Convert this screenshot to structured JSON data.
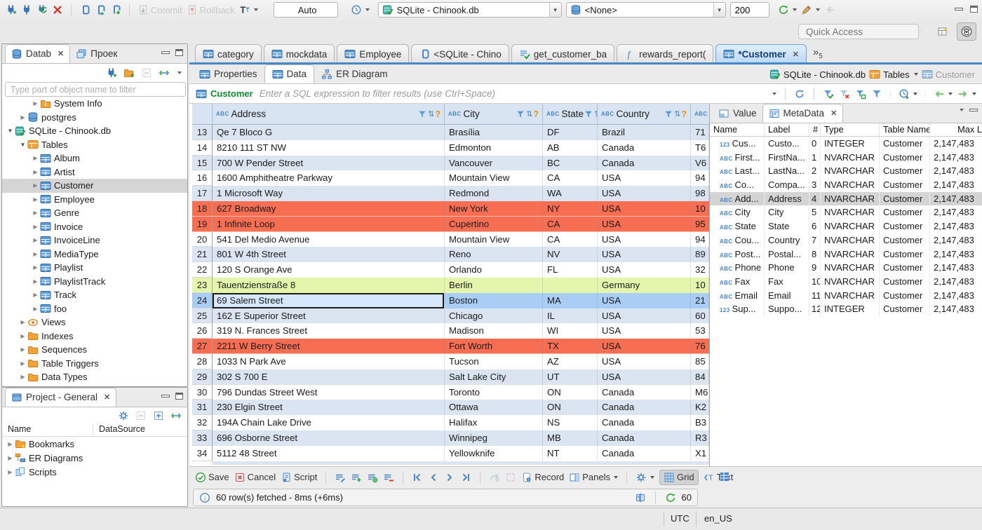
{
  "main_toolbar": {
    "commit": "Commit",
    "rollback": "Rollback",
    "txn_mode": "Auto",
    "connection": "SQLite - Chinook.db",
    "schema": "<None>",
    "fetch_size": "200",
    "quick_access_placeholder": "Quick Access"
  },
  "nav_panel": {
    "tab_database": "Datab",
    "tab_projects": "Проек",
    "filter_placeholder": "Type part of object name to filter",
    "tree": [
      {
        "label": "System Info",
        "icon": "folder-info",
        "indent": 2,
        "arrow": "right"
      },
      {
        "label": "postgres",
        "icon": "db",
        "indent": 1,
        "arrow": "right"
      },
      {
        "label": "SQLite - Chinook.db",
        "icon": "db-check",
        "indent": 0,
        "arrow": "down"
      },
      {
        "label": "Tables",
        "icon": "folder-table",
        "indent": 1,
        "arrow": "down"
      },
      {
        "label": "Album",
        "icon": "table",
        "indent": 2,
        "arrow": "right"
      },
      {
        "label": "Artist",
        "icon": "table",
        "indent": 2,
        "arrow": "right"
      },
      {
        "label": "Customer",
        "icon": "table",
        "indent": 2,
        "arrow": "right",
        "selected": true
      },
      {
        "label": "Employee",
        "icon": "table",
        "indent": 2,
        "arrow": "right"
      },
      {
        "label": "Genre",
        "icon": "table",
        "indent": 2,
        "arrow": "right"
      },
      {
        "label": "Invoice",
        "icon": "table",
        "indent": 2,
        "arrow": "right"
      },
      {
        "label": "InvoiceLine",
        "icon": "table",
        "indent": 2,
        "arrow": "right"
      },
      {
        "label": "MediaType",
        "icon": "table",
        "indent": 2,
        "arrow": "right"
      },
      {
        "label": "Playlist",
        "icon": "table",
        "indent": 2,
        "arrow": "right"
      },
      {
        "label": "PlaylistTrack",
        "icon": "table",
        "indent": 2,
        "arrow": "right"
      },
      {
        "label": "Track",
        "icon": "table",
        "indent": 2,
        "arrow": "right"
      },
      {
        "label": "foo",
        "icon": "table",
        "indent": 2,
        "arrow": "right"
      },
      {
        "label": "Views",
        "icon": "eye",
        "indent": 1,
        "arrow": "right"
      },
      {
        "label": "Indexes",
        "icon": "folder",
        "indent": 1,
        "arrow": "right"
      },
      {
        "label": "Sequences",
        "icon": "folder",
        "indent": 1,
        "arrow": "right"
      },
      {
        "label": "Table Triggers",
        "icon": "folder",
        "indent": 1,
        "arrow": "right"
      },
      {
        "label": "Data Types",
        "icon": "folder",
        "indent": 1,
        "arrow": "right"
      }
    ]
  },
  "project_panel": {
    "title": "Project - General",
    "columns": [
      "Name",
      "DataSource"
    ],
    "tree": [
      {
        "label": "Bookmarks",
        "icon": "folder-star",
        "indent": 0,
        "arrow": "right"
      },
      {
        "label": "ER Diagrams",
        "icon": "er",
        "indent": 0,
        "arrow": "right"
      },
      {
        "label": "Scripts",
        "icon": "scripts",
        "indent": 0,
        "arrow": "right"
      }
    ]
  },
  "editor_tabs": [
    {
      "label": "category",
      "icon": "table"
    },
    {
      "label": "mockdata",
      "icon": "table"
    },
    {
      "label": "Employee",
      "icon": "table"
    },
    {
      "label": "<SQLite - Chino",
      "icon": "sql"
    },
    {
      "label": "get_customer_ba",
      "icon": "script-check"
    },
    {
      "label": "rewards_report(",
      "icon": "function"
    },
    {
      "label": "*Customer",
      "icon": "table",
      "active": true,
      "closable": true
    }
  ],
  "tab_overflow_count": "5",
  "subtabs": [
    {
      "label": "Properties",
      "icon": "table"
    },
    {
      "label": "Data",
      "icon": "table",
      "active": true
    },
    {
      "label": "ER Diagram",
      "icon": "diagram"
    }
  ],
  "breadcrumb": [
    {
      "label": "SQLite - Chinook.db",
      "icon": "db-check"
    },
    {
      "label": "Tables",
      "icon": "folder-table",
      "dropdown": true
    },
    {
      "label": "Customer",
      "icon": "table",
      "muted": true
    }
  ],
  "filter_bar": {
    "entity": "Customer",
    "placeholder": "Enter a SQL expression to filter results (use Ctrl+Space)"
  },
  "grid": {
    "columns": [
      "Address",
      "City",
      "State",
      "Country"
    ],
    "partial_column_type": "ABC",
    "rows": [
      {
        "n": "13",
        "address": "Qe 7 Bloco G",
        "city": "Brasília",
        "state": "DF",
        "country": "Brazil",
        "postal": "71",
        "color": "stripe"
      },
      {
        "n": "14",
        "address": "8210 111 ST NW",
        "city": "Edmonton",
        "state": "AB",
        "country": "Canada",
        "postal": "T6",
        "color": "white"
      },
      {
        "n": "15",
        "address": "700 W Pender Street",
        "city": "Vancouver",
        "state": "BC",
        "country": "Canada",
        "postal": "V6",
        "color": "stripe"
      },
      {
        "n": "16",
        "address": "1600 Amphitheatre Parkway",
        "city": "Mountain View",
        "state": "CA",
        "country": "USA",
        "postal": "94",
        "color": "white"
      },
      {
        "n": "17",
        "address": "1 Microsoft Way",
        "city": "Redmond",
        "state": "WA",
        "country": "USA",
        "postal": "98",
        "color": "stripe"
      },
      {
        "n": "18",
        "address": "627 Broadway",
        "city": "New York",
        "state": "NY",
        "country": "USA",
        "postal": "10",
        "color": "red"
      },
      {
        "n": "19",
        "address": "1 Infinite Loop",
        "city": "Cupertino",
        "state": "CA",
        "country": "USA",
        "postal": "95",
        "color": "red"
      },
      {
        "n": "20",
        "address": "541 Del Medio Avenue",
        "city": "Mountain View",
        "state": "CA",
        "country": "USA",
        "postal": "94",
        "color": "white"
      },
      {
        "n": "21",
        "address": "801 W 4th Street",
        "city": "Reno",
        "state": "NV",
        "country": "USA",
        "postal": "89",
        "color": "stripe"
      },
      {
        "n": "22",
        "address": "120 S Orange Ave",
        "city": "Orlando",
        "state": "FL",
        "country": "USA",
        "postal": "32",
        "color": "white"
      },
      {
        "n": "23",
        "address": "Tauentzienstraße 8",
        "city": "Berlin",
        "state": "",
        "country": "Germany",
        "postal": "10",
        "color": "green"
      },
      {
        "n": "24",
        "address": "69 Salem Street",
        "city": "Boston",
        "state": "MA",
        "country": "USA",
        "postal": "21",
        "color": "sel"
      },
      {
        "n": "25",
        "address": "162 E Superior Street",
        "city": "Chicago",
        "state": "IL",
        "country": "USA",
        "postal": "60",
        "color": "stripe"
      },
      {
        "n": "26",
        "address": "319 N. Frances Street",
        "city": "Madison",
        "state": "WI",
        "country": "USA",
        "postal": "53",
        "color": "white"
      },
      {
        "n": "27",
        "address": "2211 W Berry Street",
        "city": "Fort Worth",
        "state": "TX",
        "country": "USA",
        "postal": "76",
        "color": "red"
      },
      {
        "n": "28",
        "address": "1033 N Park Ave",
        "city": "Tucson",
        "state": "AZ",
        "country": "USA",
        "postal": "85",
        "color": "white"
      },
      {
        "n": "29",
        "address": "302 S 700 E",
        "city": "Salt Lake City",
        "state": "UT",
        "country": "USA",
        "postal": "84",
        "color": "stripe"
      },
      {
        "n": "30",
        "address": "796 Dundas Street West",
        "city": "Toronto",
        "state": "ON",
        "country": "Canada",
        "postal": "M6",
        "color": "white"
      },
      {
        "n": "31",
        "address": "230 Elgin Street",
        "city": "Ottawa",
        "state": "ON",
        "country": "Canada",
        "postal": "K2",
        "color": "stripe"
      },
      {
        "n": "32",
        "address": "194A Chain Lake Drive",
        "city": "Halifax",
        "state": "NS",
        "country": "Canada",
        "postal": "B3",
        "color": "white"
      },
      {
        "n": "33",
        "address": "696 Osborne Street",
        "city": "Winnipeg",
        "state": "MB",
        "country": "Canada",
        "postal": "R3",
        "color": "stripe"
      },
      {
        "n": "34",
        "address": "5112 48 Street",
        "city": "Yellowknife",
        "state": "NT",
        "country": "Canada",
        "postal": "X1",
        "color": "white"
      }
    ]
  },
  "meta_panel": {
    "tab_value": "Value",
    "tab_metadata": "MetaData",
    "columns": [
      "Name",
      "Label",
      "#",
      "Type",
      "Table Name",
      "Max L"
    ],
    "rows": [
      {
        "kind": "123",
        "name": "Cus...",
        "label": "Custo...",
        "num": "0",
        "type": "INTEGER",
        "table": "Customer",
        "max": "2,147,483"
      },
      {
        "kind": "ABC",
        "name": "First...",
        "label": "FirstNa...",
        "num": "1",
        "type": "NVARCHAR",
        "table": "Customer",
        "max": "2,147,483"
      },
      {
        "kind": "ABC",
        "name": "Last...",
        "label": "LastNa...",
        "num": "2",
        "type": "NVARCHAR",
        "table": "Customer",
        "max": "2,147,483"
      },
      {
        "kind": "ABC",
        "name": "Co...",
        "label": "Compa...",
        "num": "3",
        "type": "NVARCHAR",
        "table": "Customer",
        "max": "2,147,483"
      },
      {
        "kind": "ABC",
        "name": "Add...",
        "label": "Address",
        "num": "4",
        "type": "NVARCHAR",
        "table": "Customer",
        "max": "2,147,483",
        "selected": true
      },
      {
        "kind": "ABC",
        "name": "City",
        "label": "City",
        "num": "5",
        "type": "NVARCHAR",
        "table": "Customer",
        "max": "2,147,483"
      },
      {
        "kind": "ABC",
        "name": "State",
        "label": "State",
        "num": "6",
        "type": "NVARCHAR",
        "table": "Customer",
        "max": "2,147,483"
      },
      {
        "kind": "ABC",
        "name": "Cou...",
        "label": "Country",
        "num": "7",
        "type": "NVARCHAR",
        "table": "Customer",
        "max": "2,147,483"
      },
      {
        "kind": "ABC",
        "name": "Post...",
        "label": "Postal...",
        "num": "8",
        "type": "NVARCHAR",
        "table": "Customer",
        "max": "2,147,483"
      },
      {
        "kind": "ABC",
        "name": "Phone",
        "label": "Phone",
        "num": "9",
        "type": "NVARCHAR",
        "table": "Customer",
        "max": "2,147,483"
      },
      {
        "kind": "ABC",
        "name": "Fax",
        "label": "Fax",
        "num": "10",
        "type": "NVARCHAR",
        "table": "Customer",
        "max": "2,147,483"
      },
      {
        "kind": "ABC",
        "name": "Email",
        "label": "Email",
        "num": "11",
        "type": "NVARCHAR",
        "table": "Customer",
        "max": "2,147,483"
      },
      {
        "kind": "123",
        "name": "Sup...",
        "label": "Suppo...",
        "num": "12",
        "type": "INTEGER",
        "table": "Customer",
        "max": "2,147,483"
      }
    ]
  },
  "bottom_toolbar": {
    "save": "Save",
    "cancel": "Cancel",
    "script": "Script",
    "record": "Record",
    "panels": "Panels",
    "grid": "Grid",
    "text": "Text"
  },
  "status_row": {
    "message": "60 row(s) fetched - 8ms (+6ms)",
    "auto_refresh": "60"
  },
  "statusbar": {
    "timezone": "UTC",
    "locale": "en_US"
  },
  "colors": {
    "row_red": "#f76e52",
    "row_green": "#e4f6ab",
    "row_selected": "#a9cdf4",
    "row_stripe": "#dbe5f1",
    "accent_blue": "#4788c7"
  }
}
